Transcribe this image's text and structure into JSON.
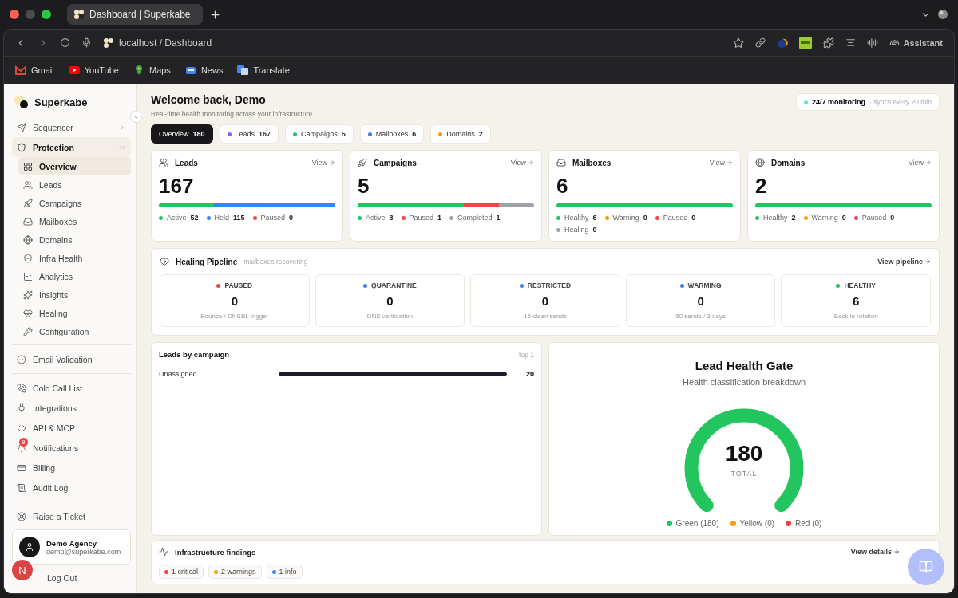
{
  "browser": {
    "tab_title": "Dashboard | Superkabe",
    "address": "localhost / Dashboard",
    "assistant_label": "Assistant",
    "bookmarks": [
      {
        "label": "Gmail",
        "kind": "gmail"
      },
      {
        "label": "YouTube",
        "kind": "youtube"
      },
      {
        "label": "Maps",
        "kind": "maps"
      },
      {
        "label": "News",
        "kind": "news"
      },
      {
        "label": "Translate",
        "kind": "translate"
      }
    ]
  },
  "sidebar": {
    "brand": "Superkabe",
    "groups": [
      [
        {
          "label": "Sequencer",
          "selected": false,
          "expanded": false
        },
        {
          "label": "Protection",
          "selected": true,
          "expanded": true,
          "children": [
            {
              "label": "Overview",
              "selected": true
            },
            {
              "label": "Leads",
              "selected": false
            },
            {
              "label": "Campaigns",
              "selected": false
            },
            {
              "label": "Mailboxes",
              "selected": false
            },
            {
              "label": "Domains",
              "selected": false
            },
            {
              "label": "Infra Health",
              "selected": false
            },
            {
              "label": "Analytics",
              "selected": false
            },
            {
              "label": "Insights",
              "selected": false
            },
            {
              "label": "Healing",
              "selected": false
            },
            {
              "label": "Configuration",
              "selected": false
            }
          ]
        }
      ],
      [
        {
          "label": "Email Validation",
          "selected": false
        }
      ],
      [
        {
          "label": "Cold Call List",
          "selected": false
        },
        {
          "label": "Integrations",
          "selected": false
        },
        {
          "label": "API & MCP",
          "selected": false
        },
        {
          "label": "Notifications",
          "selected": false,
          "badge": "9"
        },
        {
          "label": "Billing",
          "selected": false
        },
        {
          "label": "Audit Log",
          "selected": false
        }
      ],
      [
        {
          "label": "Raise a Ticket",
          "selected": false
        }
      ]
    ],
    "user": {
      "name": "Demo Agency",
      "email": "demo@superkabe.com"
    },
    "logout": "Log Out",
    "dev_badge": "N"
  },
  "header": {
    "title": "Welcome back, Demo",
    "subtitle": "Real-time health monitoring across your infrastructure.",
    "monitoring": "24/7 monitoring",
    "sync": "· syncs every 20 min"
  },
  "filters": [
    {
      "label": "Overview",
      "count": "180",
      "selected": true
    },
    {
      "label": "Leads",
      "count": "167",
      "color": "#8b5cf6",
      "selected": false
    },
    {
      "label": "Campaigns",
      "count": "5",
      "color": "#22c55e",
      "selected": false
    },
    {
      "label": "Mailboxes",
      "count": "6",
      "color": "#3b82f6",
      "selected": false
    },
    {
      "label": "Domains",
      "count": "2",
      "color": "#f59e0b",
      "selected": false
    }
  ],
  "cards": [
    {
      "title": "Leads",
      "link": "View",
      "value": "167",
      "legend": [
        {
          "label": "Active",
          "value": "52",
          "color": "#22c55e"
        },
        {
          "label": "Held",
          "value": "115",
          "color": "#3b82f6"
        },
        {
          "label": "Paused",
          "value": "0",
          "color": "#ef4444"
        }
      ]
    },
    {
      "title": "Campaigns",
      "link": "View",
      "value": "5",
      "legend": [
        {
          "label": "Active",
          "value": "3",
          "color": "#22c55e"
        },
        {
          "label": "Paused",
          "value": "1",
          "color": "#ef4444"
        },
        {
          "label": "Completed",
          "value": "1",
          "color": "#a1a1aa"
        }
      ]
    },
    {
      "title": "Mailboxes",
      "link": "View",
      "value": "6",
      "legend": [
        {
          "label": "Healthy",
          "value": "6",
          "color": "#22c55e"
        },
        {
          "label": "Warning",
          "value": "0",
          "color": "#f59e0b"
        },
        {
          "label": "Paused",
          "value": "0",
          "color": "#ef4444"
        },
        {
          "label": "Healing",
          "value": "0",
          "color": "#a1a1aa"
        }
      ]
    },
    {
      "title": "Domains",
      "link": "View",
      "value": "2",
      "legend": [
        {
          "label": "Healthy",
          "value": "2",
          "color": "#22c55e"
        },
        {
          "label": "Warning",
          "value": "0",
          "color": "#f59e0b"
        },
        {
          "label": "Paused",
          "value": "0",
          "color": "#ef4444"
        }
      ]
    }
  ],
  "pipeline": {
    "title": "Healing Pipeline",
    "subtitle": "mailboxes recovering",
    "link": "View pipeline",
    "stages": [
      {
        "label": "PAUSED",
        "value": "0",
        "note": "Bounce / DNSBL trigger",
        "color": "#ef4444"
      },
      {
        "label": "QUARANTINE",
        "value": "0",
        "note": "DNS verification",
        "color": "#3b82f6"
      },
      {
        "label": "RESTRICTED",
        "value": "0",
        "note": "15 clean sends",
        "color": "#3b82f6"
      },
      {
        "label": "WARMING",
        "value": "0",
        "note": "50 sends / 3 days",
        "color": "#3b82f6"
      },
      {
        "label": "HEALTHY",
        "value": "6",
        "note": "Back in rotation",
        "color": "#22c55e"
      }
    ]
  },
  "leads_by_campaign": {
    "title": "Leads by campaign",
    "tag": "top 1",
    "rows": [
      {
        "label": "Unassigned",
        "value": "20",
        "level": 1
      }
    ]
  },
  "health_gate": {
    "title": "Lead Health Gate",
    "subtitle": "Health classification breakdown",
    "total": "180",
    "total_label": "TOTAL",
    "legend": [
      {
        "label": "Green (180)",
        "color": "#22c55e"
      },
      {
        "label": "Yellow (0)",
        "color": "#f59e0b"
      },
      {
        "label": "Red (0)",
        "color": "#ef4444"
      }
    ]
  },
  "findings": {
    "title": "Infrastructure findings",
    "link": "View details",
    "chips": [
      {
        "label": "1 critical",
        "color": "#ef4444"
      },
      {
        "label": "2 warnings",
        "color": "#f59e0b"
      },
      {
        "label": "1 info",
        "color": "#3b82f6"
      }
    ]
  }
}
